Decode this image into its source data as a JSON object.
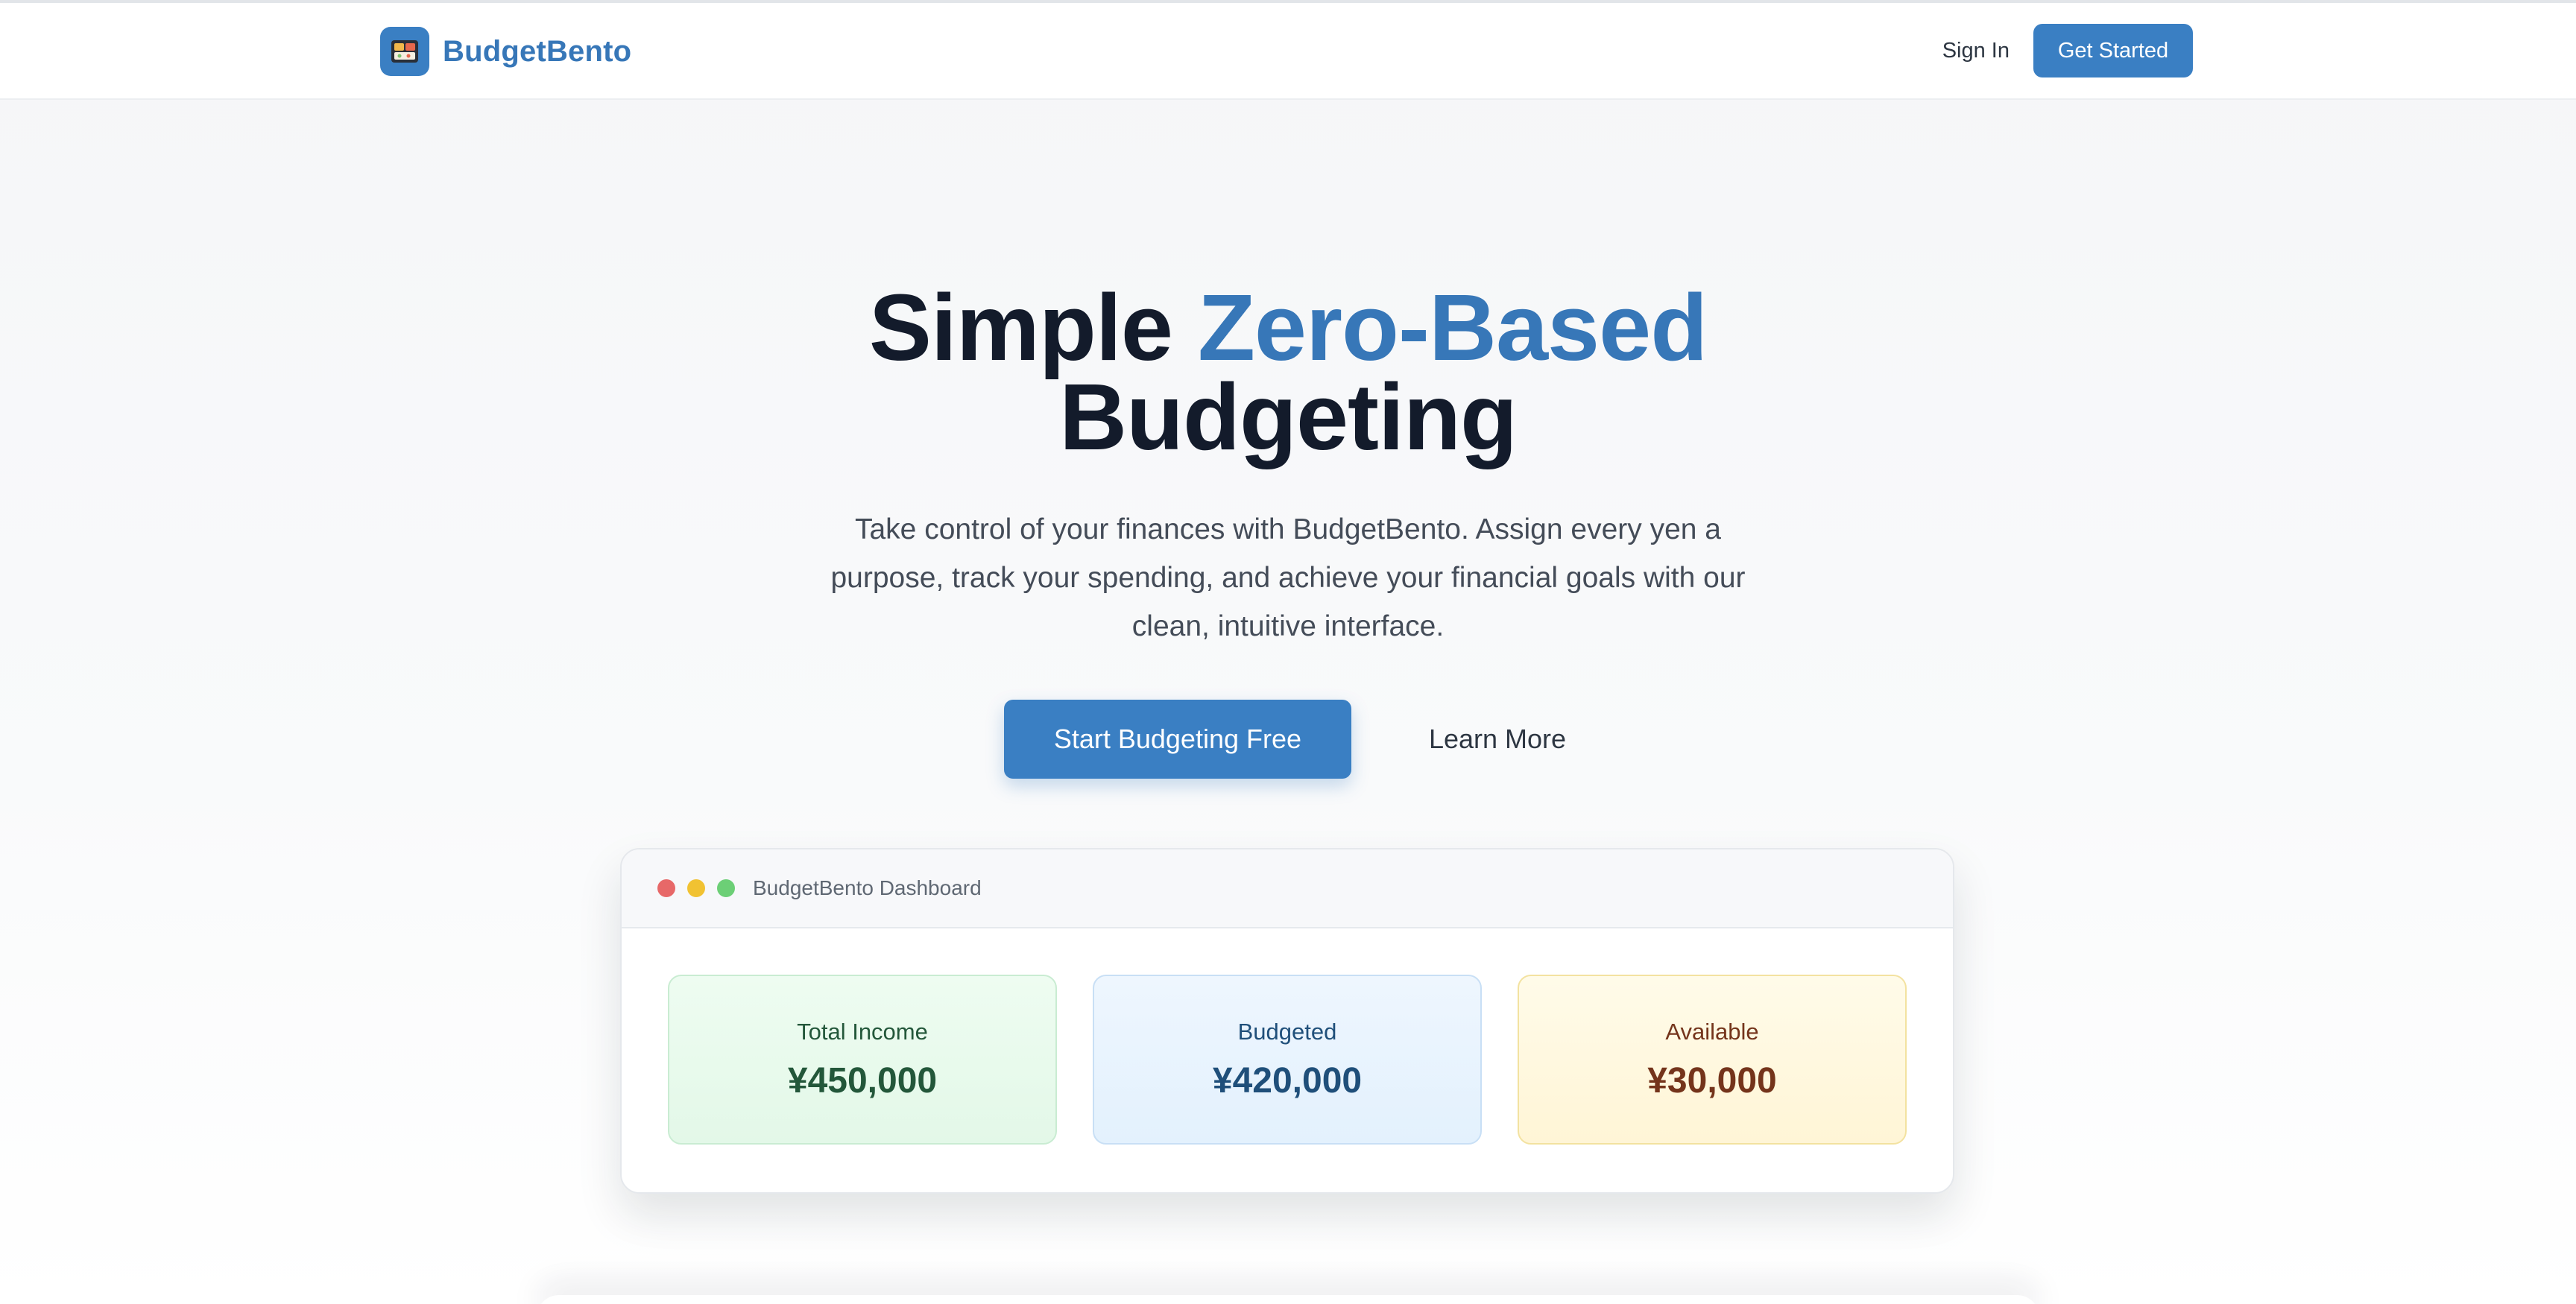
{
  "header": {
    "brand": "BudgetBento",
    "logo_icon": "bento-box-icon",
    "sign_in_label": "Sign In",
    "get_started_label": "Get Started"
  },
  "hero": {
    "title_part1": "Simple ",
    "title_accent": "Zero-Based",
    "title_part2": "Budgeting",
    "subtitle": "Take control of your finances with BudgetBento. Assign every yen a purpose, track your spending, and achieve your financial goals with our clean, intuitive interface.",
    "primary_cta": "Start Budgeting Free",
    "secondary_cta": "Learn More"
  },
  "dashboard": {
    "window_title": "BudgetBento Dashboard",
    "cards": [
      {
        "label": "Total Income",
        "value": "¥450,000"
      },
      {
        "label": "Budgeted",
        "value": "¥420,000"
      },
      {
        "label": "Available",
        "value": "¥30,000"
      }
    ]
  },
  "colors": {
    "brand": "#3777b8",
    "primary_button": "#3a7fc3",
    "income_text": "#23573a",
    "budgeted_text": "#1f4f7a",
    "available_text": "#74341b"
  }
}
